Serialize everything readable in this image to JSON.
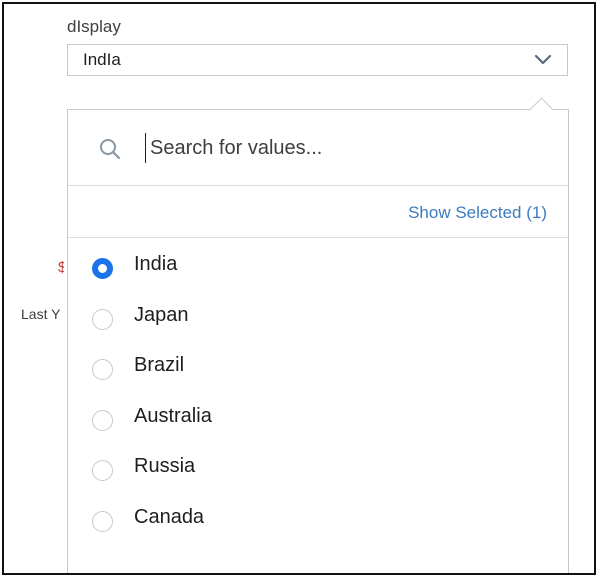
{
  "filter": {
    "label": "dIsplay",
    "selected_value": "IndIa"
  },
  "background": {
    "partial_red_text": "$",
    "partial_text": "Last Y"
  },
  "dropdown": {
    "search_placeholder": "Search for values...",
    "show_selected": "Show Selected (1)",
    "options": [
      {
        "label": "India",
        "selected": true
      },
      {
        "label": "Japan",
        "selected": false
      },
      {
        "label": "Brazil",
        "selected": false
      },
      {
        "label": "Australia",
        "selected": false
      },
      {
        "label": "Russia",
        "selected": false
      },
      {
        "label": "Canada",
        "selected": false
      }
    ]
  },
  "colors": {
    "accent": "#1a73e8",
    "link": "#3c7bbf",
    "border": "#c9c9c9",
    "red_text": "#c23934"
  },
  "icons": {
    "chevron": "chevron-down-icon",
    "search": "search-icon",
    "radio_checked": "radio-checked-icon",
    "radio_unchecked": "radio-unchecked-icon"
  }
}
